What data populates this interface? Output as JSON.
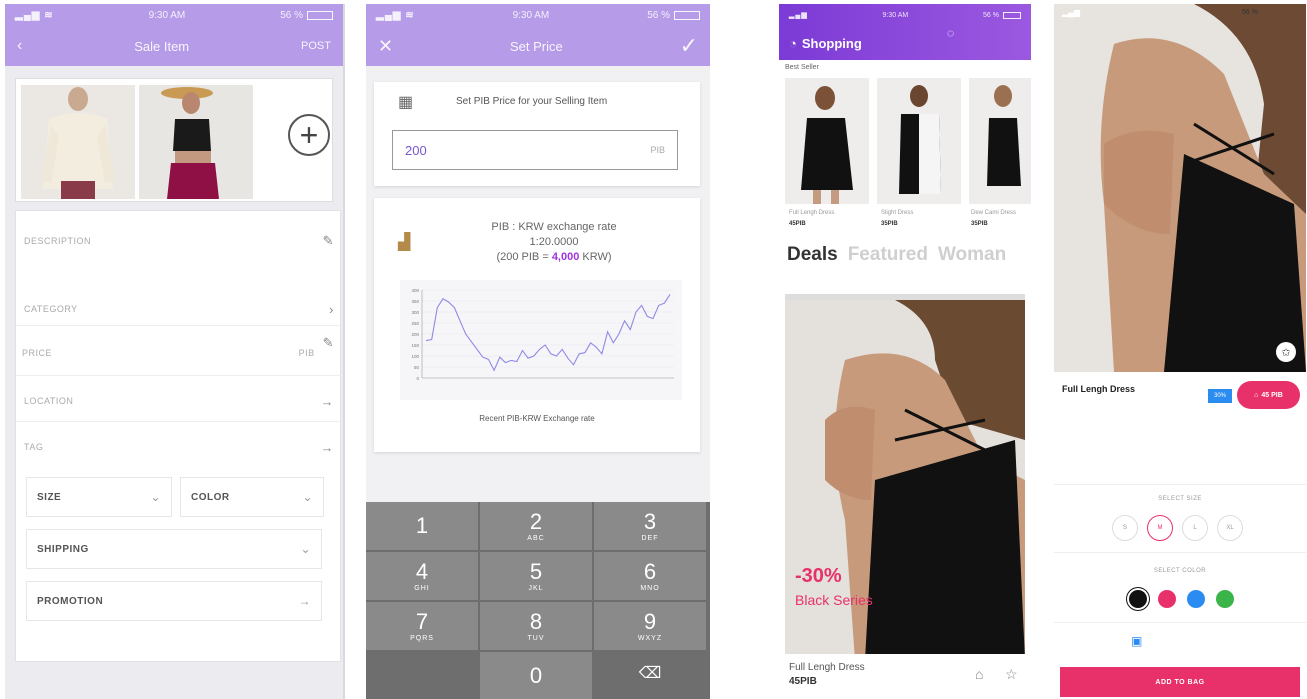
{
  "sale_item": {
    "status_time": "9:30 AM",
    "status_battery": "56 %",
    "title": "Sale Item",
    "back_icon": "chevron-left-icon",
    "post_label": "POST",
    "add_photo_icon": "plus-circle-icon",
    "fields": {
      "description": "DESCRIPTION",
      "category": "CATEGORY",
      "price": "PRICE",
      "price_unit": "PIB",
      "location": "LOCATION",
      "tag": "TAG",
      "size": "SIZE",
      "color": "COLOR",
      "shipping": "SHIPPING",
      "promotion": "PROMOTION"
    }
  },
  "set_price": {
    "status_time": "9:30 AM",
    "status_battery": "56 %",
    "title": "Set Price",
    "prompt": "Set PIB Price for your Selling Item",
    "input_value": "200",
    "input_unit": "PIB",
    "rate_title": "PIB : KRW exchange rate",
    "rate_value": "1:20.0000",
    "rate_example_prefix": "(200 PIB = ",
    "rate_example_amount": "4,000",
    "rate_example_suffix": " KRW)",
    "chart_caption": "Recent PIB-KRW Exchange rate",
    "keys": [
      {
        "n": "1",
        "l": ""
      },
      {
        "n": "2",
        "l": "ABC"
      },
      {
        "n": "3",
        "l": "DEF"
      },
      {
        "n": "4",
        "l": "GHI"
      },
      {
        "n": "5",
        "l": "JKL"
      },
      {
        "n": "6",
        "l": "MNO"
      },
      {
        "n": "7",
        "l": "PQRS"
      },
      {
        "n": "8",
        "l": "TUV"
      },
      {
        "n": "9",
        "l": "WXYZ"
      },
      {
        "n": "0",
        "l": ""
      }
    ]
  },
  "chart_data": {
    "type": "line",
    "y_ticks": [
      "400",
      "350",
      "300",
      "250",
      "200",
      "150",
      "100",
      "50",
      "0"
    ],
    "ylim": [
      0,
      400
    ],
    "series": [
      {
        "name": "",
        "values": [
          170,
          175,
          320,
          360,
          345,
          320,
          260,
          200,
          165,
          130,
          95,
          85,
          35,
          95,
          70,
          80,
          75,
          125,
          90,
          100,
          130,
          150,
          110,
          100,
          130,
          90,
          60,
          110,
          115,
          160,
          140,
          110,
          210,
          160,
          200,
          260,
          220,
          300,
          330,
          280,
          270,
          330,
          340,
          380
        ]
      }
    ],
    "grid": true
  },
  "shopping": {
    "status_time": "9:30 AM",
    "status_battery": "56 %",
    "title": "Shopping",
    "best_seller": "Best Seller",
    "thumbs": [
      {
        "name": "Full Lengh Dress",
        "price": "45PIB"
      },
      {
        "name": "Slight Dress",
        "price": "35PIB"
      },
      {
        "name": "Dew Cami Dress",
        "price": "35PIB"
      }
    ],
    "tabs": [
      "Deals",
      "Featured",
      "Woman"
    ],
    "hero_discount": "-30%",
    "hero_subtitle": "Black Series",
    "product_name": "Full Lengh Dress",
    "product_price": "45PIB"
  },
  "detail": {
    "status_battery": "56 %",
    "title": "Full Lengh Dress",
    "badge": "30%",
    "price": "45 PIB",
    "select_size": "SELECT SIZE",
    "sizes": [
      "S",
      "M",
      "L",
      "XL"
    ],
    "select_color": "SELECT COLOR",
    "colors": [
      "#111111",
      "#e8316a",
      "#2a8cf0",
      "#3bb44a"
    ],
    "add_to_bag": "ADD TO BAG"
  }
}
